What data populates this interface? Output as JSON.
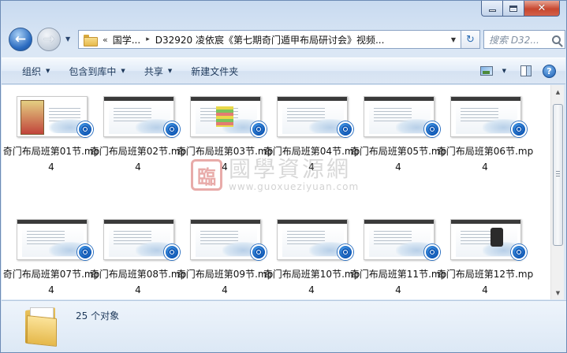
{
  "window": {
    "caption_buttons": [
      "minimize",
      "maximize",
      "close"
    ],
    "close_glyph": "✕"
  },
  "navigation": {
    "back_icon": "back-arrow-icon",
    "back_glyph": "←",
    "forward_icon": "forward-arrow-icon",
    "forward_glyph": "→",
    "history_glyph": "▼"
  },
  "address": {
    "overflow_glyph": "«",
    "crumbs": [
      "国学...",
      "D32920  凌依宸《第七期奇门遁甲布局研讨会》视频..."
    ],
    "separator_glyph": "▸",
    "dropdown_glyph": "▼",
    "refresh_glyph": "↻"
  },
  "search": {
    "placeholder": "搜索 D32..."
  },
  "toolbar": {
    "organize": "组织",
    "include_in_library": "包含到库中",
    "share": "共享",
    "new_folder": "新建文件夹",
    "dropdown_glyph": "▼",
    "help_glyph": "?"
  },
  "files": [
    {
      "name": "奇门布局班第01节.mp4",
      "thumb": "cover"
    },
    {
      "name": "奇门布局班第02节.mp4",
      "thumb": "slide"
    },
    {
      "name": "奇门布局班第03节.mp4",
      "thumb": "table"
    },
    {
      "name": "奇门布局班第04节.mp4",
      "thumb": "slide"
    },
    {
      "name": "奇门布局班第05节.mp4",
      "thumb": "slide"
    },
    {
      "name": "奇门布局班第06节.mp4",
      "thumb": "slide"
    },
    {
      "name": "奇门布局班第07节.mp4",
      "thumb": "slide"
    },
    {
      "name": "奇门布局班第08节.mp4",
      "thumb": "slide"
    },
    {
      "name": "奇门布局班第09节.mp4",
      "thumb": "slide"
    },
    {
      "name": "奇门布局班第10节.mp4",
      "thumb": "slide"
    },
    {
      "name": "奇门布局班第11节.mp4",
      "thumb": "slide"
    },
    {
      "name": "奇门布局班第12节.mp4",
      "thumb": "device"
    }
  ],
  "watermark": {
    "seal": "臨",
    "name": "國學資源網",
    "url": "www.guoxueziyuan.com"
  },
  "scrollbar": {
    "up_glyph": "▲",
    "down_glyph": "▼"
  },
  "details": {
    "count": "25 个对象"
  },
  "colors": {
    "badge": "#0d57b5",
    "close_button": "#c7472f",
    "seal": "#c4251f"
  }
}
